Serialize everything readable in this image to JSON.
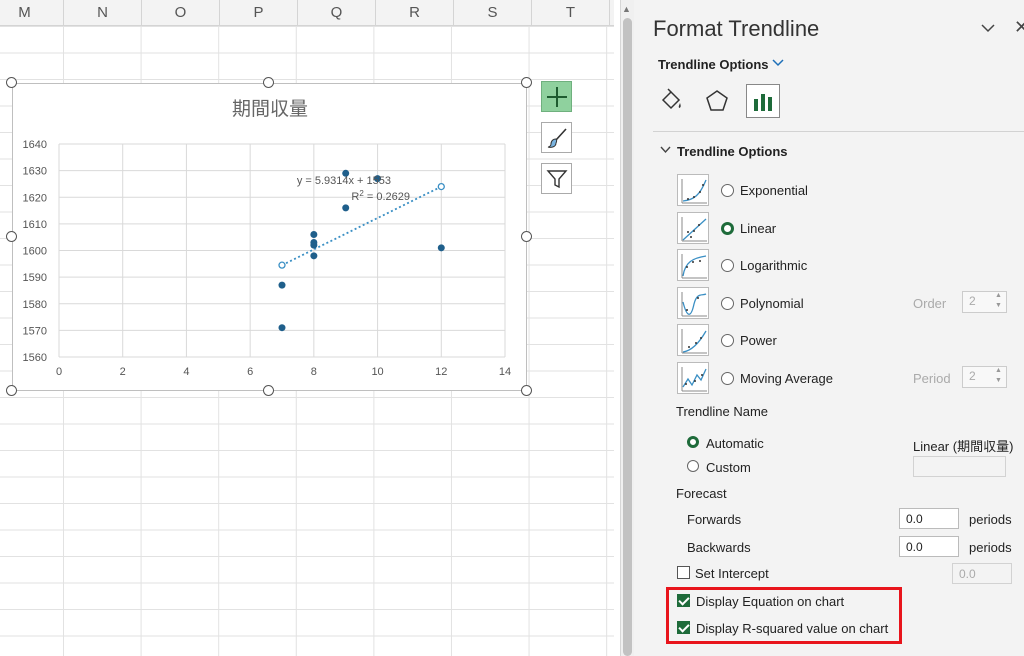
{
  "sheet": {
    "columns": [
      "M",
      "N",
      "O",
      "P",
      "Q",
      "R",
      "S",
      "T"
    ]
  },
  "chart": {
    "toolbar_icons": [
      "plus-icon",
      "brush-icon",
      "filter-icon"
    ]
  },
  "chart_data": {
    "type": "scatter",
    "title": "期間収量",
    "xlim": [
      0,
      14
    ],
    "ylim": [
      1560,
      1640
    ],
    "x_ticks": [
      0,
      2,
      4,
      6,
      8,
      10,
      12,
      14
    ],
    "y_ticks": [
      1560,
      1570,
      1580,
      1590,
      1600,
      1610,
      1620,
      1630,
      1640
    ],
    "grid": true,
    "series": [
      {
        "points": [
          [
            7,
            1571
          ],
          [
            7,
            1587
          ],
          [
            8,
            1598
          ],
          [
            8,
            1602
          ],
          [
            8,
            1603
          ],
          [
            8,
            1606
          ],
          [
            9,
            1616
          ],
          [
            9,
            1629
          ],
          [
            10,
            1627
          ],
          [
            12,
            1601
          ]
        ]
      }
    ],
    "trendline": {
      "type": "linear",
      "x_range": [
        7,
        12
      ],
      "y_range": [
        1594.5,
        1624
      ]
    },
    "equation_text": "y = 5.9314x + 1553",
    "r2_label": "R",
    "r2_sup": "2",
    "r2_value": " = 0.2629",
    "colors": {
      "marker": "#1f5f8b",
      "trend": "#3a8fc4"
    }
  },
  "panel": {
    "title": "Format Trendline",
    "collapse_icon": "chevron-down-icon",
    "close_icon": "close-icon",
    "tab_header": "Trendline Options",
    "tabs": [
      "fill-icon",
      "effects-icon",
      "bar-chart-icon"
    ],
    "section_title": "Trendline Options",
    "options": [
      {
        "label": "Exponential",
        "selected": false
      },
      {
        "label": "Linear",
        "selected": true
      },
      {
        "label": "Logarithmic",
        "selected": false
      },
      {
        "label": "Polynomial",
        "selected": false,
        "extra_label": "Order",
        "extra_value": "2"
      },
      {
        "label": "Power",
        "selected": false
      },
      {
        "label": "Moving Average",
        "selected": false,
        "extra_label": "Period",
        "extra_value": "2"
      }
    ],
    "trendline_name": {
      "heading": "Trendline Name",
      "automatic_label": "Automatic",
      "automatic_value": "Linear (期間収量)",
      "custom_label": "Custom",
      "custom_value": ""
    },
    "forecast": {
      "heading": "Forecast",
      "forwards_label": "Forwards",
      "forwards_value": "0.0",
      "backwards_label": "Backwards",
      "backwards_value": "0.0",
      "unit": "periods"
    },
    "set_intercept": {
      "label": "Set Intercept",
      "value": "0.0",
      "checked": false
    },
    "display_equation": {
      "label": "Display Equation on chart",
      "checked": true
    },
    "display_r2": {
      "label": "Display R-squared value on chart",
      "checked": true
    },
    "highlight_color": "#e8141b",
    "accent": "#1e6b3a"
  }
}
